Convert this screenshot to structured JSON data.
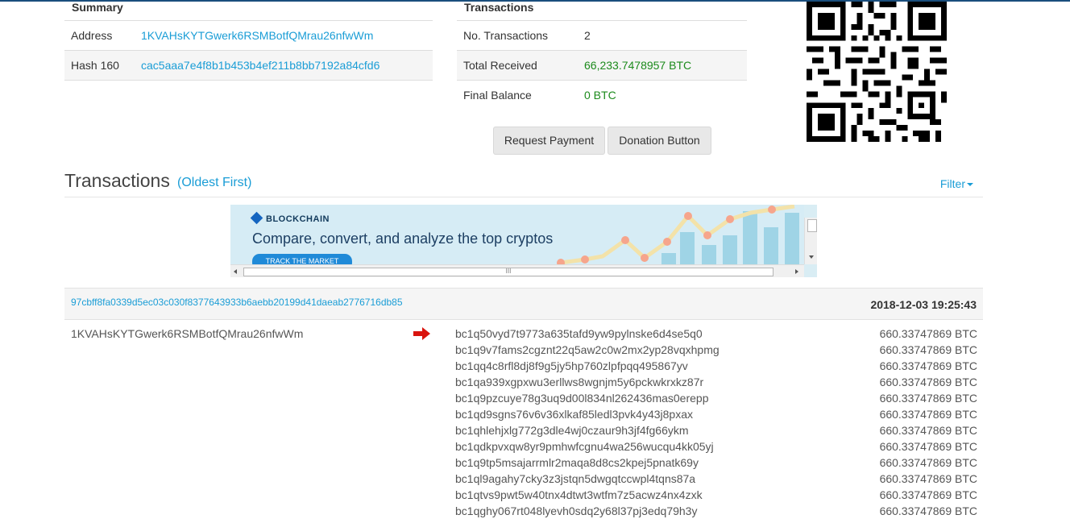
{
  "summary": {
    "title": "Summary",
    "address_label": "Address",
    "address_value": "1KVAHsKYTGwerk6RSMBotfQMrau26nfwWm",
    "hash160_label": "Hash 160",
    "hash160_value": "cac5aaa7e4f8b1b453b4ef211b8bb7192a84cfd6"
  },
  "transactions_summary": {
    "title": "Transactions",
    "no_tx_label": "No. Transactions",
    "no_tx_value": "2",
    "total_received_label": "Total Received",
    "total_received_value": "66,233.7478957 BTC",
    "final_balance_label": "Final Balance",
    "final_balance_value": "0 BTC"
  },
  "buttons": {
    "request_payment": "Request Payment",
    "donation_button": "Donation Button"
  },
  "transactions_section": {
    "heading": "Transactions",
    "sort_label": "(Oldest First)",
    "filter_label": "Filter"
  },
  "ad": {
    "brand": "BLOCKCHAIN",
    "headline": "Compare, convert, and analyze the top cryptos",
    "cta": "TRACK THE MARKET",
    "hscroll_grip": "III"
  },
  "transaction": {
    "hash": "97cbff8fa0339d5ec03c030f8377643933b6aebb20199d41daeab2776716db85",
    "time": "2018-12-03 19:25:43",
    "from_address": "1KVAHsKYTGwerk6RSMBotfQMrau26nfwWm",
    "outputs": [
      {
        "address": "bc1q50vyd7t9773a635tafd9yw9pylnske6d4se5q0",
        "amount": "660.33747869 BTC"
      },
      {
        "address": "bc1q9v7fams2cgznt22q5aw2c0w2mx2yp28vqxhpmg",
        "amount": "660.33747869 BTC"
      },
      {
        "address": "bc1qq4c8rfl8dj8f9g5jy5hp760zlpfpqq495867yv",
        "amount": "660.33747869 BTC"
      },
      {
        "address": "bc1qa939xgpxwu3erllws8wgnjm5y6pckwkrxkz87r",
        "amount": "660.33747869 BTC"
      },
      {
        "address": "bc1q9pzcuye78g3uq9d00l834nl262436mas0erepp",
        "amount": "660.33747869 BTC"
      },
      {
        "address": "bc1qd9sgns76v6v36xlkaf85ledl3pvk4y43j8pxax",
        "amount": "660.33747869 BTC"
      },
      {
        "address": "bc1qhlehjxlg772g3dle4wj0czaur9h3jf4fg66ykm",
        "amount": "660.33747869 BTC"
      },
      {
        "address": "bc1qdkpvxqw8yr9pmhwfcgnu4wa256wucqu4kk05yj",
        "amount": "660.33747869 BTC"
      },
      {
        "address": "bc1q9tp5msajarrmlr2maqa8d8cs2kpej5pnatk69y",
        "amount": "660.33747869 BTC"
      },
      {
        "address": "bc1ql9agahy7cky3z3jstqn5dwgqtccwpl4tqns87a",
        "amount": "660.33747869 BTC"
      },
      {
        "address": "bc1qtvs9pwt5w40tnx4dtwt3wtfm7z5acwz4nx4zxk",
        "amount": "660.33747869 BTC"
      },
      {
        "address": "bc1qghy067rt048lyevh0sdq2y68l37pj3edq79h3y",
        "amount": "660.33747869 BTC"
      }
    ]
  },
  "colors": {
    "link": "#1a9dd6",
    "positive": "#1c8a1c",
    "arrow": "#d9140e",
    "topbar": "#1a4e7d"
  },
  "icons": {
    "qr": "qr-code-icon",
    "direction": "right-arrow-icon",
    "filter": "caret-down-icon"
  }
}
